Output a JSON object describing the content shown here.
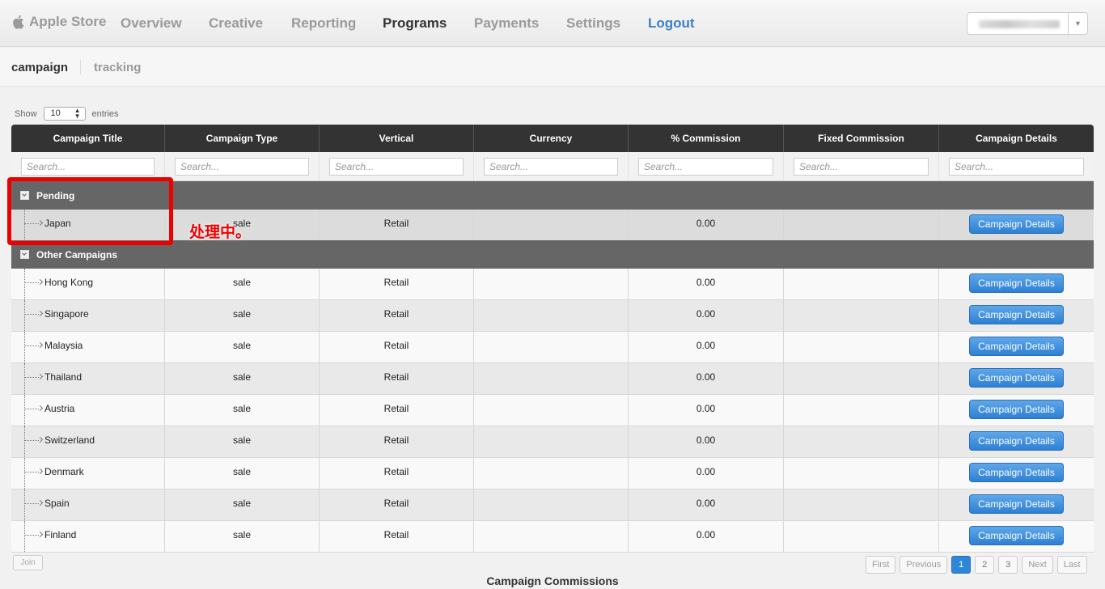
{
  "nav": {
    "brand": "Apple Store",
    "items": [
      "Overview",
      "Creative",
      "Reporting",
      "Programs",
      "Payments",
      "Settings",
      "Logout"
    ],
    "active": "Programs"
  },
  "subnav": {
    "items": [
      "campaign",
      "tracking"
    ],
    "active": "campaign"
  },
  "table_controls": {
    "show_label": "Show",
    "entries_value": "10",
    "entries_label": "entries"
  },
  "table": {
    "columns": [
      "Campaign Title",
      "Campaign Type",
      "Vertical",
      "Currency",
      "% Commission",
      "Fixed Commission",
      "Campaign Details"
    ],
    "search_placeholder": "Search...",
    "groups": [
      {
        "name": "Pending",
        "rows": [
          {
            "title": "Japan",
            "type": "sale",
            "vertical": "Retail",
            "currency": "",
            "pct": "0.00",
            "fixed": "",
            "button": "Campaign Details"
          }
        ]
      },
      {
        "name": "Other Campaigns",
        "rows": [
          {
            "title": "Hong Kong",
            "type": "sale",
            "vertical": "Retail",
            "currency": "",
            "pct": "0.00",
            "fixed": "",
            "button": "Campaign Details"
          },
          {
            "title": "Singapore",
            "type": "sale",
            "vertical": "Retail",
            "currency": "",
            "pct": "0.00",
            "fixed": "",
            "button": "Campaign Details"
          },
          {
            "title": "Malaysia",
            "type": "sale",
            "vertical": "Retail",
            "currency": "",
            "pct": "0.00",
            "fixed": "",
            "button": "Campaign Details"
          },
          {
            "title": "Thailand",
            "type": "sale",
            "vertical": "Retail",
            "currency": "",
            "pct": "0.00",
            "fixed": "",
            "button": "Campaign Details"
          },
          {
            "title": "Austria",
            "type": "sale",
            "vertical": "Retail",
            "currency": "",
            "pct": "0.00",
            "fixed": "",
            "button": "Campaign Details"
          },
          {
            "title": "Switzerland",
            "type": "sale",
            "vertical": "Retail",
            "currency": "",
            "pct": "0.00",
            "fixed": "",
            "button": "Campaign Details"
          },
          {
            "title": "Denmark",
            "type": "sale",
            "vertical": "Retail",
            "currency": "",
            "pct": "0.00",
            "fixed": "",
            "button": "Campaign Details"
          },
          {
            "title": "Spain",
            "type": "sale",
            "vertical": "Retail",
            "currency": "",
            "pct": "0.00",
            "fixed": "",
            "button": "Campaign Details"
          },
          {
            "title": "Finland",
            "type": "sale",
            "vertical": "Retail",
            "currency": "",
            "pct": "0.00",
            "fixed": "",
            "button": "Campaign Details"
          }
        ]
      }
    ]
  },
  "annotation": {
    "text": "处理中。",
    "color": "#ee0000"
  },
  "footer": {
    "join_label": "Join",
    "pagination": [
      "First",
      "Previous",
      "1",
      "2",
      "3",
      "Next",
      "Last"
    ],
    "current_page": "1",
    "caption": "Campaign Commissions"
  },
  "colors": {
    "header_bg": "#333333",
    "group_bg": "#666666",
    "button_blue": "#2e80d4",
    "logout_blue": "#3b82c4"
  }
}
